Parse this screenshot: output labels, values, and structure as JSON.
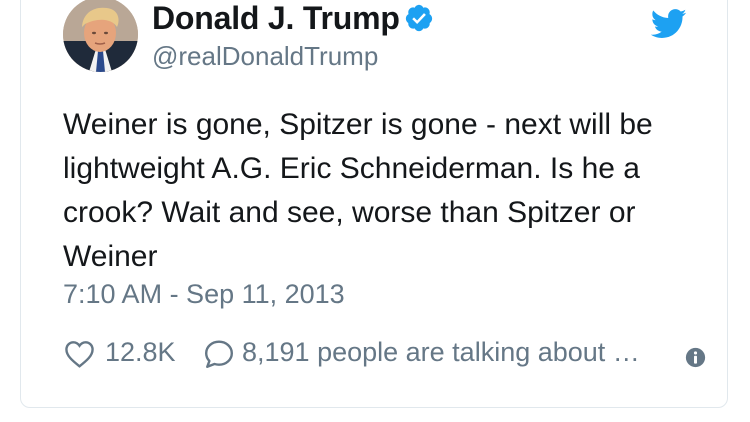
{
  "tweet": {
    "author": {
      "name": "Donald J. Trump",
      "handle": "@realDonaldTrump",
      "verified": true,
      "avatar_icon": "profile-photo"
    },
    "text": "Weiner is gone, Spitzer is gone - next will be lightweight A.G. Eric Schneiderman. Is he a crook? Wait and see, worse than Spitzer or Weiner",
    "timestamp": "7:10 AM - Sep 11, 2013",
    "actions": {
      "like_count": "12.8K",
      "talking_text": "8,191 people are talking about …"
    },
    "icons": {
      "verified": "verified-badge-icon",
      "brand": "twitter-bird-icon",
      "like": "heart-icon",
      "reply": "speech-bubble-icon",
      "info": "info-icon"
    }
  },
  "colors": {
    "brand_blue": "#1da1f2",
    "text_primary": "#14171a",
    "text_secondary": "#657786",
    "border": "#e1e8ed"
  }
}
